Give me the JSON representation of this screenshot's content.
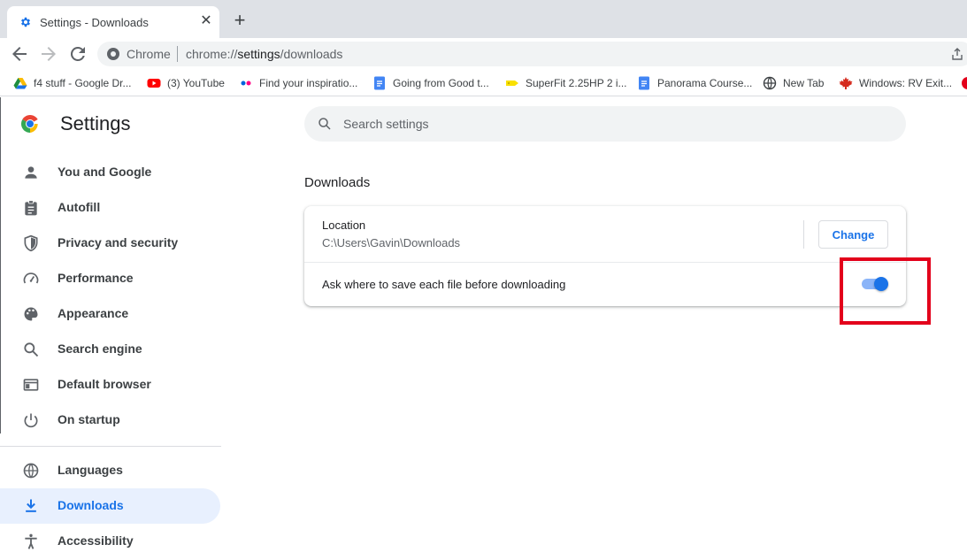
{
  "browser": {
    "tab_title": "Settings - Downloads",
    "tab_close": "✕",
    "new_tab": "+",
    "omnibox_site": "Chrome",
    "url_prefix": "chrome://",
    "url_host": "settings",
    "url_path": "/downloads"
  },
  "bookmarks": [
    {
      "label": "f4 stuff - Google Dr...",
      "icon": "google-drive-icon"
    },
    {
      "label": "(3) YouTube",
      "icon": "youtube-icon"
    },
    {
      "label": "Find your inspiratio...",
      "icon": "flickr-icon"
    },
    {
      "label": "Going from Good t...",
      "icon": "google-docs-icon"
    },
    {
      "label": "SuperFit 2.25HP 2 i...",
      "icon": "tag-icon"
    },
    {
      "label": "Panorama Course...",
      "icon": "google-docs-icon"
    },
    {
      "label": "New Tab",
      "icon": "globe-icon"
    },
    {
      "label": "Windows: RV Exit...",
      "icon": "maple-leaf-icon"
    }
  ],
  "sidebar": {
    "title": "Settings",
    "items": [
      {
        "label": "You and Google",
        "icon": "person-icon"
      },
      {
        "label": "Autofill",
        "icon": "clipboard-icon"
      },
      {
        "label": "Privacy and security",
        "icon": "shield-icon"
      },
      {
        "label": "Performance",
        "icon": "speedometer-icon"
      },
      {
        "label": "Appearance",
        "icon": "palette-icon"
      },
      {
        "label": "Search engine",
        "icon": "search-icon"
      },
      {
        "label": "Default browser",
        "icon": "browser-window-icon"
      },
      {
        "label": "On startup",
        "icon": "power-icon"
      },
      {
        "label": "Languages",
        "icon": "globe-icon"
      },
      {
        "label": "Downloads",
        "icon": "download-icon",
        "active": true
      },
      {
        "label": "Accessibility",
        "icon": "accessibility-icon"
      }
    ]
  },
  "search": {
    "placeholder": "Search settings"
  },
  "downloads": {
    "section_title": "Downloads",
    "location_label": "Location",
    "location_path": "C:\\Users\\Gavin\\Downloads",
    "change_button": "Change",
    "ask_label": "Ask where to save each file before downloading",
    "ask_enabled": true
  },
  "colors": {
    "accent": "#1a73e8",
    "active_bg": "#e8f0fe",
    "highlight": "#e3001b"
  }
}
